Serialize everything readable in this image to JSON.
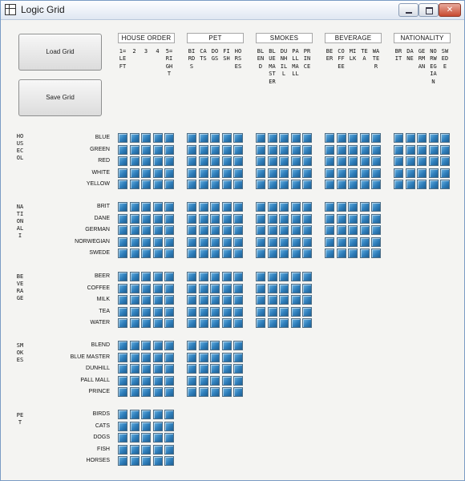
{
  "window": {
    "title": "Logic Grid"
  },
  "buttons": {
    "load": "Load Grid",
    "save": "Save Grid"
  },
  "column_categories": [
    {
      "key": "house_order",
      "label": "HOUSE ORDER",
      "items": [
        "1=LEFT",
        "2",
        "3",
        "4",
        "5=RIGHT"
      ]
    },
    {
      "key": "pet",
      "label": "PET",
      "items": [
        "BIRDS",
        "CATS",
        "DOGS",
        "FISH",
        "HORSES"
      ]
    },
    {
      "key": "smokes",
      "label": "SMOKES",
      "items": [
        "BLEND",
        "BLUEMASTER",
        "DUNHILL",
        "PALLMALL",
        "PRINCE"
      ]
    },
    {
      "key": "beverage",
      "label": "BEVERAGE",
      "items": [
        "BEER",
        "COFFEE",
        "MILK",
        "TEA",
        "WATER"
      ]
    },
    {
      "key": "nationality",
      "label": "NATIONALITY",
      "items": [
        "BRIT",
        "DANE",
        "GERMAN",
        "NORWEGIAN",
        "SWEDE"
      ]
    }
  ],
  "row_categories": [
    {
      "key": "housecolor",
      "label": "HOUSECOL",
      "items": [
        "BLUE",
        "GREEN",
        "RED",
        "WHITE",
        "YELLOW"
      ],
      "grids": 5
    },
    {
      "key": "nationality",
      "label": "NATIONALI",
      "items": [
        "BRIT",
        "DANE",
        "GERMAN",
        "NORWEGIAN",
        "SWEDE"
      ],
      "grids": 4
    },
    {
      "key": "beverage",
      "label": "BEVERAGE",
      "items": [
        "BEER",
        "COFFEE",
        "MILK",
        "TEA",
        "WATER"
      ],
      "grids": 3
    },
    {
      "key": "smokes",
      "label": "SMOKES",
      "items": [
        "BLEND",
        "BLUE MASTER",
        "DUNHILL",
        "PALL MALL",
        "PRINCE"
      ],
      "grids": 2
    },
    {
      "key": "pet",
      "label": "PET",
      "items": [
        "BIRDS",
        "CATS",
        "DOGS",
        "FISH",
        "HORSES"
      ],
      "grids": 1
    }
  ],
  "colors": {
    "cell_fill": "#2f7fbc",
    "cell_border": "#4c6d86",
    "title_bar": "#dfe7f2"
  }
}
